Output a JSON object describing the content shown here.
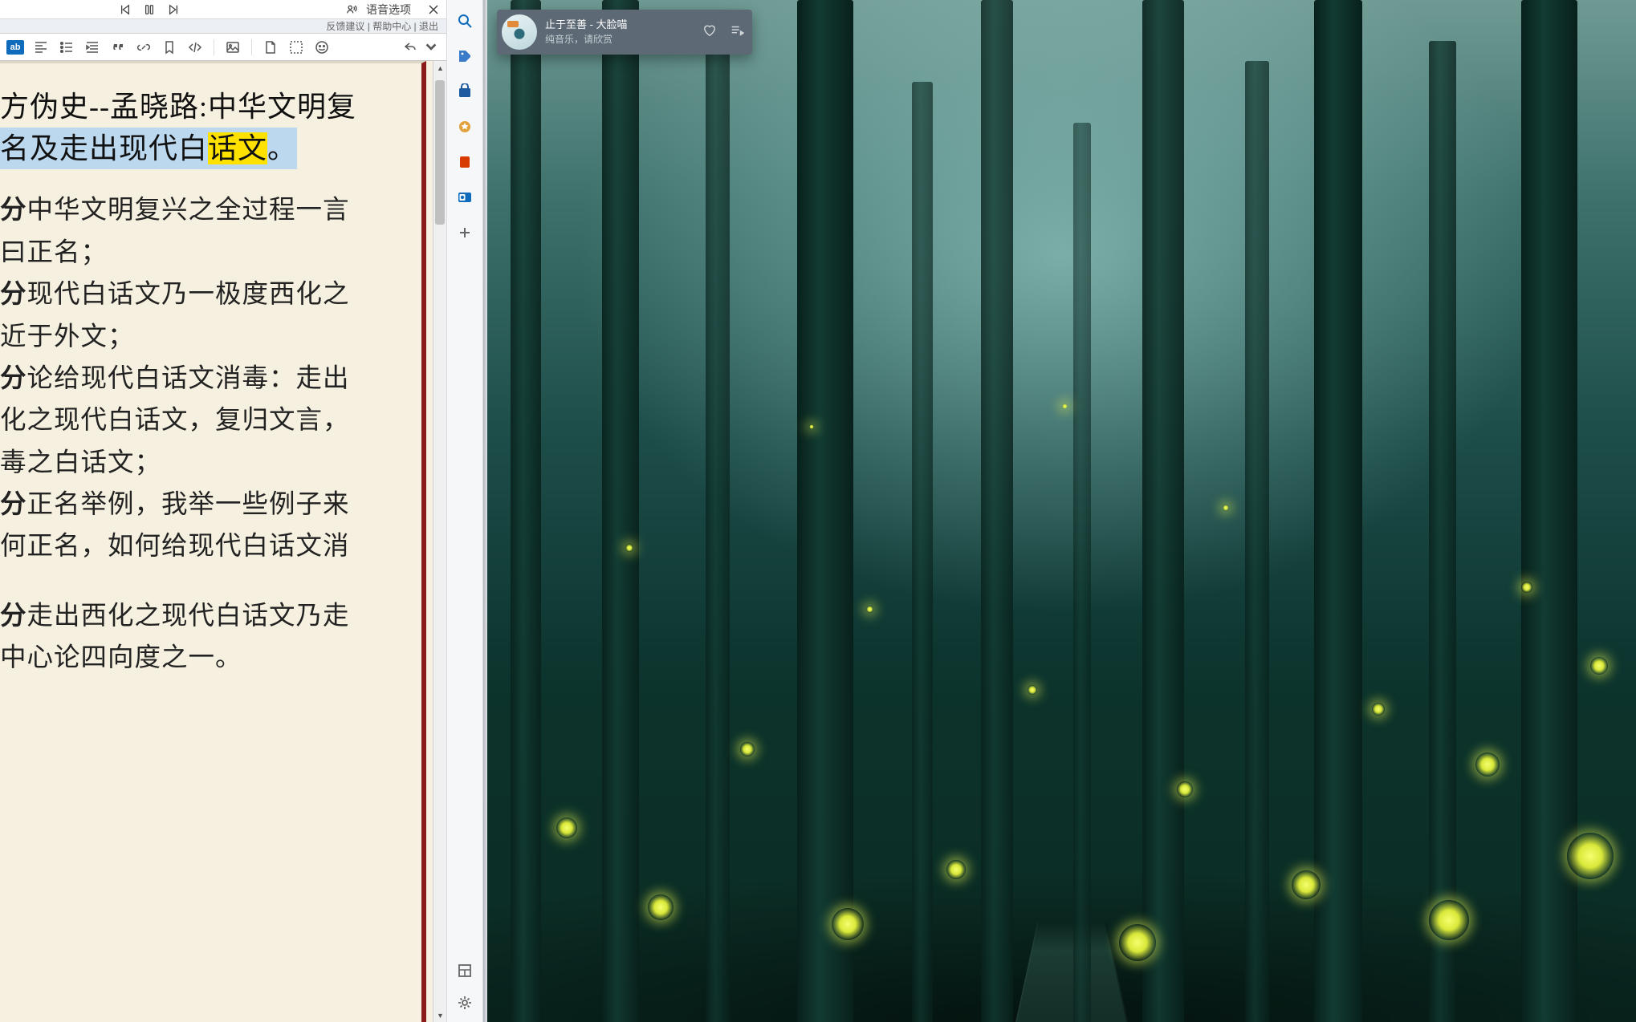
{
  "player": {
    "voice_options_label": "语音选项"
  },
  "link_strip": {
    "text": "反馈建议 | 帮助中心 | 退出"
  },
  "toolbar": {
    "ab_label": "ab"
  },
  "doc": {
    "title_line1": "方伪史--孟晓路:中华文明复",
    "title_line2_a": "名及走出现代白",
    "title_line2_b": "话文",
    "title_line2_c": "。",
    "body": {
      "p1a": "分",
      "p1b": "中华文明复兴之全过程一言",
      "p2": "曰正名；",
      "p3a": "分",
      "p3b": "现代白话文乃一极度西化之",
      "p4": "近于外文；",
      "p5a": "分",
      "p5b": "论给现代白话文消毒：走出",
      "p6": "化之现代白话文，复归文言，",
      "p7": "毒之白话文；",
      "p8a": "分",
      "p8b": "正名举例，我举一些例子来",
      "p9": "何正名，如何给现代白话文消",
      "p10": "",
      "p11a": "分",
      "p11b": "走出西化之现代白话文乃走",
      "p12": "中心论四向度之一。"
    }
  },
  "music": {
    "title": "止于至善 - 大脸喵",
    "subtitle": "纯音乐，请欣赏"
  }
}
